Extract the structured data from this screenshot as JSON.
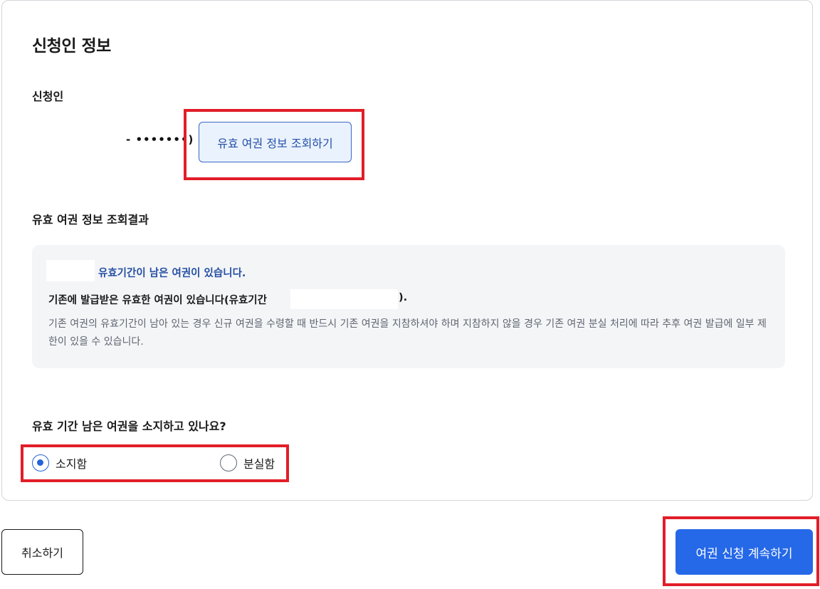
{
  "applicant_section": {
    "title": "신청인 정보",
    "field_label": "신청인",
    "id_masked": "- •••••••)",
    "lookup_button": "유효 여권 정보 조회하기"
  },
  "result": {
    "title": "유효 여권 정보 조회결과",
    "headline": "유효기간이 남은 여권이 있습니다.",
    "line2": "기존에 발급받은 유효한 여권이 있습니다(유효기간",
    "line2_close": ").",
    "description": "기존 여권의 유효기간이 남아 있는 경우 신규 여권을 수령할 때 반드시 기존 여권을 지참하셔야 하며 지참하지 않을 경우 기존 여권 분실 처리에 따라 추후 여권 발급에 일부 제한이 있을 수 있습니다."
  },
  "possession": {
    "question": "유효 기간 남은 여권을 소지하고 있나요?",
    "options": [
      {
        "label": "소지함",
        "selected": true
      },
      {
        "label": "분실함",
        "selected": false
      }
    ]
  },
  "footer": {
    "cancel": "취소하기",
    "continue": "여권 신청 계속하기"
  },
  "colors": {
    "accent": "#2568e8",
    "highlight": "#e11e28",
    "info_text": "#244fa3"
  }
}
